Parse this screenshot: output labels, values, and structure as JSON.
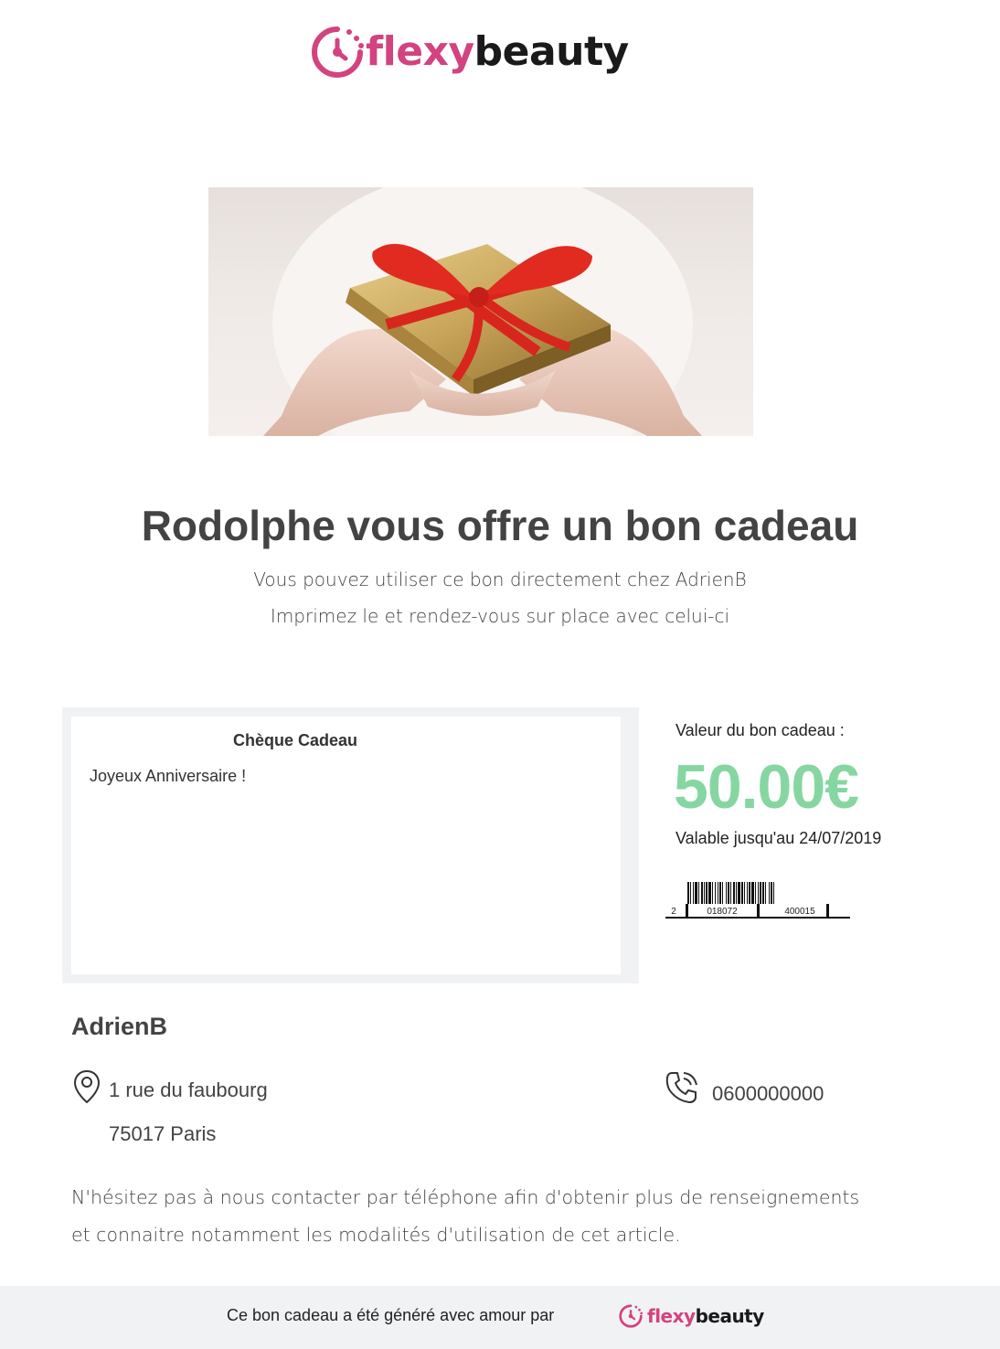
{
  "brand": {
    "name_part1": "flexy",
    "name_part2": "beauty",
    "icon": "clock-check-icon",
    "color": "#d2437f"
  },
  "hero": {
    "description_icon": "gift-photo"
  },
  "title": "Rodolphe vous offre un bon cadeau",
  "subtitle": {
    "line1": "Vous pouvez utiliser ce bon directement chez AdrienB",
    "line2": "Imprimez le et rendez-vous sur place avec celui-ci"
  },
  "card": {
    "title": "Chèque Cadeau",
    "message": "Joyeux Anniversaire !"
  },
  "voucher": {
    "value_label": "Valeur du bon cadeau :",
    "amount": "50.00€",
    "amount_color": "#86d6a2",
    "validity": "Valable jusqu'au 24/07/2019",
    "barcode_digits": {
      "d1": "2",
      "d2": "018072",
      "d3": "400015"
    }
  },
  "merchant": {
    "name": "AdrienB",
    "address_line1": "1 rue du faubourg",
    "address_line2": "75017 Paris",
    "phone": "0600000000"
  },
  "contact": {
    "line1": "N'hésitez pas à nous contacter par téléphone afin d'obtenir plus de renseignements",
    "line2": "et connaitre notamment les modalités d'utilisation de cet article."
  },
  "footer": {
    "text": "Ce bon cadeau a été généré avec amour par"
  }
}
